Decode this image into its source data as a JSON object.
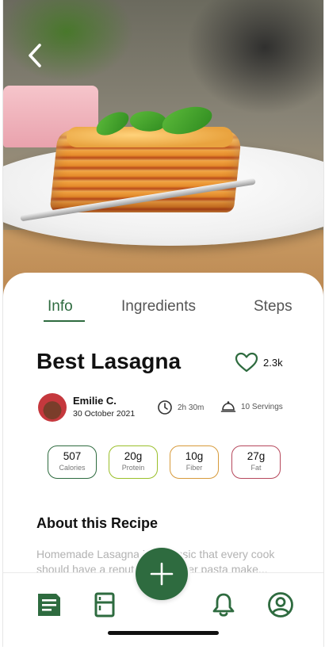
{
  "header": {
    "back_icon": "chevron-left-icon"
  },
  "tabs": [
    {
      "label": "Info",
      "active": true
    },
    {
      "label": "Ingredients",
      "active": false
    },
    {
      "label": "Steps",
      "active": false
    }
  ],
  "recipe": {
    "title": "Best Lasagna",
    "likes": "2.3k",
    "author": {
      "name": "Emilie C.",
      "date": "30 October 2021"
    },
    "time": "2h 30m",
    "servings": "10 Servings"
  },
  "nutrition": [
    {
      "value": "507",
      "label": "Calories",
      "color": "#2e6b3f"
    },
    {
      "value": "20g",
      "label": "Protein",
      "color": "#9abf2a"
    },
    {
      "value": "10g",
      "label": "Fiber",
      "color": "#d79a3a"
    },
    {
      "value": "27g",
      "label": "Fat",
      "color": "#b6485c"
    }
  ],
  "about": {
    "title": "About this Recipe",
    "text": "Homemade Lasagna is a classic that every cook should have a reputation. Tender pasta make..."
  },
  "bottom_nav": {
    "items": [
      "recipes-icon",
      "fridge-icon",
      "bell-icon",
      "profile-icon"
    ],
    "fab_icon": "plus-icon"
  },
  "colors": {
    "accent": "#2e6b3f"
  }
}
